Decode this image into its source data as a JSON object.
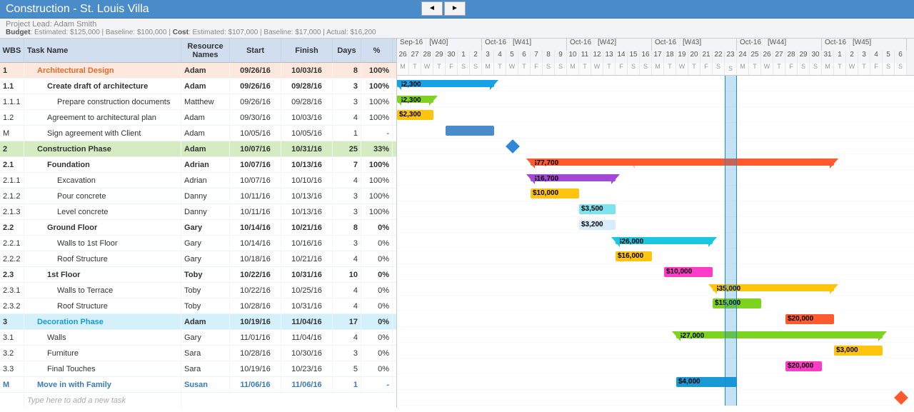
{
  "title": "Construction - St. Louis Villa",
  "project_lead_label": "Project Lead:",
  "project_lead": "Adam Smith",
  "budget_line": {
    "budget_label": "Budget",
    "est_label": "Estimated:",
    "est": "$125,000",
    "base_label": "Baseline:",
    "base": "$100,000",
    "cost_label": "Cost",
    "cest": "$107,000",
    "cbase": "$17,000",
    "act_label": "Actual:",
    "act": "$16,200"
  },
  "columns": {
    "wbs": "WBS",
    "task": "Task Name",
    "res": "Resource Names",
    "start": "Start",
    "finish": "Finish",
    "days": "Days",
    "pct": "%"
  },
  "new_task_placeholder": "Type here to add a new task",
  "weeks": [
    {
      "month": "Sep-16",
      "wk": "[W40]",
      "days": [
        "26",
        "27",
        "28",
        "29",
        "30",
        "1",
        "2"
      ],
      "dow": [
        "M",
        "T",
        "W",
        "T",
        "F",
        "S",
        "S"
      ]
    },
    {
      "month": "Oct-16",
      "wk": "[W41]",
      "days": [
        "3",
        "4",
        "5",
        "6",
        "7",
        "8",
        "9"
      ],
      "dow": [
        "M",
        "T",
        "W",
        "T",
        "F",
        "S",
        "S"
      ]
    },
    {
      "month": "Oct-16",
      "wk": "[W42]",
      "days": [
        "10",
        "11",
        "12",
        "13",
        "14",
        "15",
        "16"
      ],
      "dow": [
        "M",
        "T",
        "W",
        "T",
        "F",
        "S",
        "S"
      ]
    },
    {
      "month": "Oct-16",
      "wk": "[W43]",
      "days": [
        "17",
        "18",
        "19",
        "20",
        "21",
        "22",
        "23"
      ],
      "dow": [
        "M",
        "T",
        "W",
        "T",
        "F",
        "S",
        "S"
      ]
    },
    {
      "month": "Oct-16",
      "wk": "[W44]",
      "days": [
        "24",
        "25",
        "26",
        "27",
        "28",
        "29",
        "30"
      ],
      "dow": [
        "M",
        "T",
        "W",
        "T",
        "F",
        "S",
        "S"
      ]
    },
    {
      "month": "Oct-16",
      "wk": "[W45]",
      "days": [
        "31",
        "1",
        "2",
        "3",
        "4",
        "5",
        "6"
      ],
      "dow": [
        "M",
        "T",
        "W",
        "T",
        "F",
        "S",
        "S"
      ]
    }
  ],
  "today_col": 27,
  "rows": [
    {
      "wbs": "1",
      "task": "Architectural Design",
      "res": "Adam",
      "start": "09/26/16",
      "finish": "10/03/16",
      "days": "8",
      "pct": "100%",
      "class": "summary phase1",
      "ind": 1,
      "bar": {
        "type": "summary",
        "x": 0,
        "w": 8,
        "label": "$2,300",
        "color": "#18a2e6"
      }
    },
    {
      "wbs": "1.1",
      "task": "Create draft of architecture",
      "res": "Adam",
      "start": "09/26/16",
      "finish": "09/28/16",
      "days": "3",
      "pct": "100%",
      "class": "summary",
      "ind": 2,
      "bar": {
        "type": "summary",
        "x": 0,
        "w": 3,
        "label": "$2,300",
        "color": "#7ed321"
      }
    },
    {
      "wbs": "1.1.1",
      "task": "Prepare construction documents",
      "res": "Matthew",
      "start": "09/26/16",
      "finish": "09/28/16",
      "days": "3",
      "pct": "100%",
      "ind": 3,
      "bar": {
        "type": "task",
        "x": 0,
        "w": 3,
        "label": "$2,300",
        "color": "#ffc40d"
      }
    },
    {
      "wbs": "1.2",
      "task": "Agreement to architectural plan",
      "res": "Adam",
      "start": "09/30/16",
      "finish": "10/03/16",
      "days": "4",
      "pct": "100%",
      "ind": 2,
      "bar": {
        "type": "task",
        "x": 4,
        "w": 4,
        "label": "",
        "color": "#4a8bc9"
      }
    },
    {
      "wbs": "M",
      "task": "Sign agreement with Client",
      "res": "Adam",
      "start": "10/05/16",
      "finish": "10/05/16",
      "days": "1",
      "pct": "-",
      "ind": 2,
      "bar": {
        "type": "milestone",
        "x": 9,
        "color": "#2d88d8"
      }
    },
    {
      "wbs": "2",
      "task": "Construction Phase",
      "res": "Adam",
      "start": "10/07/16",
      "finish": "10/31/16",
      "days": "25",
      "pct": "33%",
      "class": "summary phase2",
      "ind": 1,
      "bar": {
        "type": "summary",
        "x": 11,
        "w": 25,
        "label": "$77,700",
        "color": "#ff5a2d",
        "progress": 0.33
      }
    },
    {
      "wbs": "2.1",
      "task": "Foundation",
      "res": "Adrian",
      "start": "10/07/16",
      "finish": "10/13/16",
      "days": "7",
      "pct": "100%",
      "class": "summary",
      "ind": 2,
      "bar": {
        "type": "summary",
        "x": 11,
        "w": 7,
        "label": "$16,700",
        "color": "#a349d6"
      }
    },
    {
      "wbs": "2.1.1",
      "task": "Excavation",
      "res": "Adrian",
      "start": "10/07/16",
      "finish": "10/10/16",
      "days": "4",
      "pct": "100%",
      "ind": 3,
      "bar": {
        "type": "task",
        "x": 11,
        "w": 4,
        "label": "$10,000",
        "color": "#ffc40d"
      }
    },
    {
      "wbs": "2.1.2",
      "task": "Pour concrete",
      "res": "Danny",
      "start": "10/11/16",
      "finish": "10/13/16",
      "days": "3",
      "pct": "100%",
      "ind": 3,
      "bar": {
        "type": "task",
        "x": 15,
        "w": 3,
        "label": "$3,500",
        "color": "#7de3ef"
      }
    },
    {
      "wbs": "2.1.3",
      "task": "Level concrete",
      "res": "Danny",
      "start": "10/11/16",
      "finish": "10/13/16",
      "days": "3",
      "pct": "100%",
      "ind": 3,
      "bar": {
        "type": "task",
        "x": 15,
        "w": 3,
        "label": "$3,200",
        "color": "#d7ecff"
      }
    },
    {
      "wbs": "2.2",
      "task": "Ground Floor",
      "res": "Gary",
      "start": "10/14/16",
      "finish": "10/21/16",
      "days": "8",
      "pct": "0%",
      "class": "summary",
      "ind": 2,
      "bar": {
        "type": "summary",
        "x": 18,
        "w": 8,
        "label": "$26,000",
        "color": "#1bc7e0"
      }
    },
    {
      "wbs": "2.2.1",
      "task": "Walls to 1st Floor",
      "res": "Gary",
      "start": "10/14/16",
      "finish": "10/16/16",
      "days": "3",
      "pct": "0%",
      "ind": 3,
      "bar": {
        "type": "task",
        "x": 18,
        "w": 3,
        "label": "$16,000",
        "color": "#ffc40d"
      }
    },
    {
      "wbs": "2.2.2",
      "task": "Roof Structure",
      "res": "Gary",
      "start": "10/18/16",
      "finish": "10/21/16",
      "days": "4",
      "pct": "0%",
      "ind": 3,
      "bar": {
        "type": "task",
        "x": 22,
        "w": 4,
        "label": "$10,000",
        "color": "#ff3cc7"
      }
    },
    {
      "wbs": "2.3",
      "task": "1st Floor",
      "res": "Toby",
      "start": "10/22/16",
      "finish": "10/31/16",
      "days": "10",
      "pct": "0%",
      "class": "summary",
      "ind": 2,
      "bar": {
        "type": "summary",
        "x": 26,
        "w": 10,
        "label": "$35,000",
        "color": "#ffc40d"
      }
    },
    {
      "wbs": "2.3.1",
      "task": "Walls to Terrace",
      "res": "Toby",
      "start": "10/22/16",
      "finish": "10/25/16",
      "days": "4",
      "pct": "0%",
      "ind": 3,
      "bar": {
        "type": "task",
        "x": 26,
        "w": 4,
        "label": "$15,000",
        "color": "#7ed321"
      }
    },
    {
      "wbs": "2.3.2",
      "task": "Roof Structure",
      "res": "Toby",
      "start": "10/28/16",
      "finish": "10/31/16",
      "days": "4",
      "pct": "0%",
      "ind": 3,
      "bar": {
        "type": "task",
        "x": 32,
        "w": 4,
        "label": "$20,000",
        "color": "#ff5a2d"
      }
    },
    {
      "wbs": "3",
      "task": "Decoration Phase",
      "res": "Adam",
      "start": "10/19/16",
      "finish": "11/04/16",
      "days": "17",
      "pct": "0%",
      "class": "summary phase3",
      "ind": 1,
      "bar": {
        "type": "summary",
        "x": 23,
        "w": 17,
        "label": "$27,000",
        "color": "#7ed321"
      }
    },
    {
      "wbs": "3.1",
      "task": "Walls",
      "res": "Gary",
      "start": "11/01/16",
      "finish": "11/04/16",
      "days": "4",
      "pct": "0%",
      "ind": 2,
      "bar": {
        "type": "task",
        "x": 36,
        "w": 4,
        "label": "$3,000",
        "color": "#ffc40d"
      }
    },
    {
      "wbs": "3.2",
      "task": "Furniture",
      "res": "Sara",
      "start": "10/28/16",
      "finish": "10/30/16",
      "days": "3",
      "pct": "0%",
      "ind": 2,
      "bar": {
        "type": "task",
        "x": 32,
        "w": 3,
        "label": "$20,000",
        "color": "#ff3cc7"
      }
    },
    {
      "wbs": "3.3",
      "task": "Final Touches",
      "res": "Sara",
      "start": "10/19/16",
      "finish": "10/23/16",
      "days": "5",
      "pct": "0%",
      "ind": 2,
      "bar": {
        "type": "task",
        "x": 23,
        "w": 5,
        "label": "$4,000",
        "color": "#1a9ad4"
      }
    },
    {
      "wbs": "M",
      "task": "Move in with Family",
      "res": "Susan",
      "start": "11/06/16",
      "finish": "11/06/16",
      "days": "1",
      "pct": "-",
      "class": "milestone",
      "ind": 1,
      "bar": {
        "type": "milestone",
        "x": 41,
        "color": "#ff5a2d"
      }
    }
  ]
}
